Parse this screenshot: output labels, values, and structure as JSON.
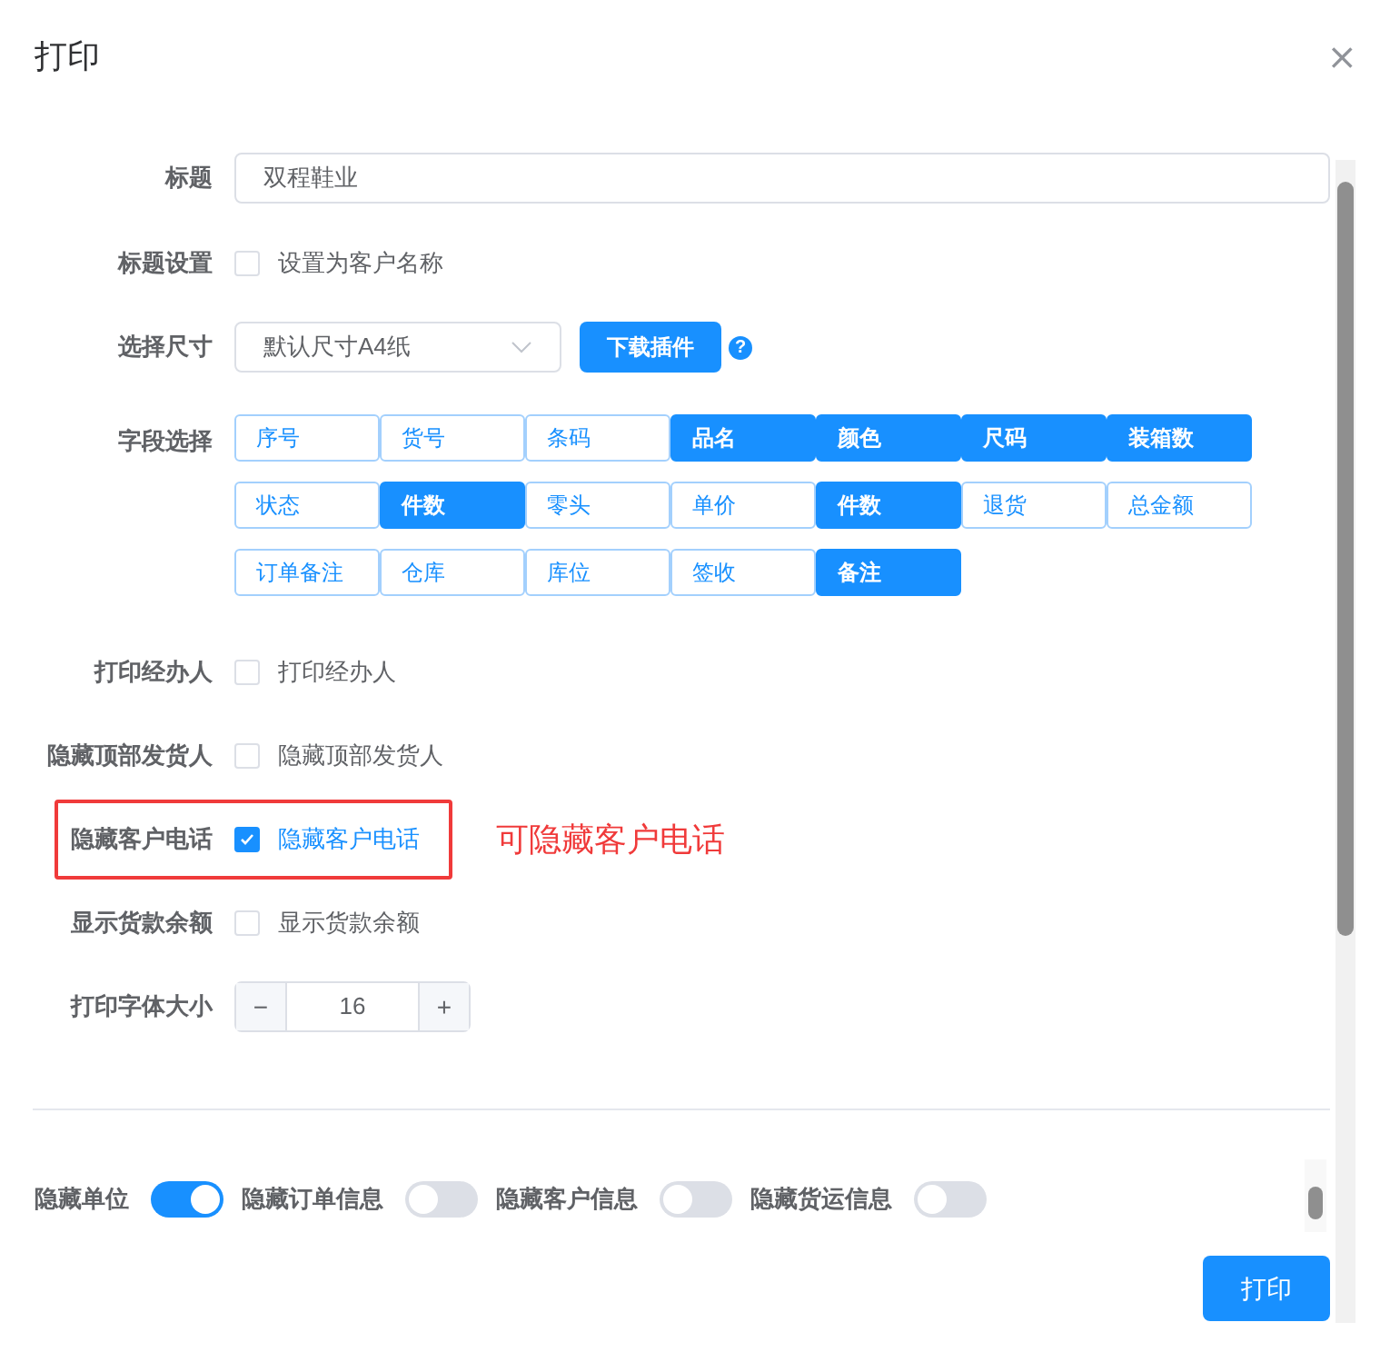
{
  "dialog": {
    "title": "打印",
    "close": "×"
  },
  "form": [
    {
      "kind": "text",
      "label": "标题",
      "value": "双程鞋业"
    },
    {
      "kind": "checkbox",
      "label": "标题设置",
      "text": "设置为客户名称",
      "checked": false
    },
    {
      "kind": "select",
      "label": "选择尺寸",
      "value": "默认尺寸A4纸",
      "button": "下载插件",
      "help": "?"
    },
    {
      "kind": "fields",
      "label": "字段选择",
      "options": [
        {
          "label": "序号",
          "selected": false
        },
        {
          "label": "货号",
          "selected": false
        },
        {
          "label": "条码",
          "selected": false
        },
        {
          "label": "品名",
          "selected": true
        },
        {
          "label": "颜色",
          "selected": true
        },
        {
          "label": "尺码",
          "selected": true
        },
        {
          "label": "装箱数",
          "selected": true
        },
        {
          "label": "状态",
          "selected": false
        },
        {
          "label": "件数",
          "selected": true
        },
        {
          "label": "零头",
          "selected": false
        },
        {
          "label": "单价",
          "selected": false
        },
        {
          "label": "件数",
          "selected": true
        },
        {
          "label": "退货",
          "selected": false
        },
        {
          "label": "总金额",
          "selected": false
        },
        {
          "label": "订单备注",
          "selected": false
        },
        {
          "label": "仓库",
          "selected": false
        },
        {
          "label": "库位",
          "selected": false
        },
        {
          "label": "签收",
          "selected": false
        },
        {
          "label": "备注",
          "selected": true
        }
      ]
    },
    {
      "kind": "checkbox",
      "label": "打印经办人",
      "text": "打印经办人",
      "checked": false
    },
    {
      "kind": "checkbox",
      "label": "隐藏顶部发货人",
      "text": "隐藏顶部发货人",
      "checked": false
    },
    {
      "kind": "checkbox",
      "label": "隐藏客户电话",
      "text": "隐藏客户电话",
      "checked": true,
      "highlighted": true,
      "note": "可隐藏客户电话"
    },
    {
      "kind": "checkbox",
      "label": "显示货款余额",
      "text": "显示货款余额",
      "checked": false
    },
    {
      "kind": "stepper",
      "label": "打印字体大小",
      "value": "16",
      "minus": "−",
      "plus": "+"
    }
  ],
  "switches": [
    {
      "label": "隐藏单位",
      "on": true
    },
    {
      "label": "隐藏订单信息",
      "on": false
    },
    {
      "label": "隐藏客户信息",
      "on": false
    },
    {
      "label": "隐藏货运信息",
      "on": false
    }
  ],
  "print_button": "打印"
}
